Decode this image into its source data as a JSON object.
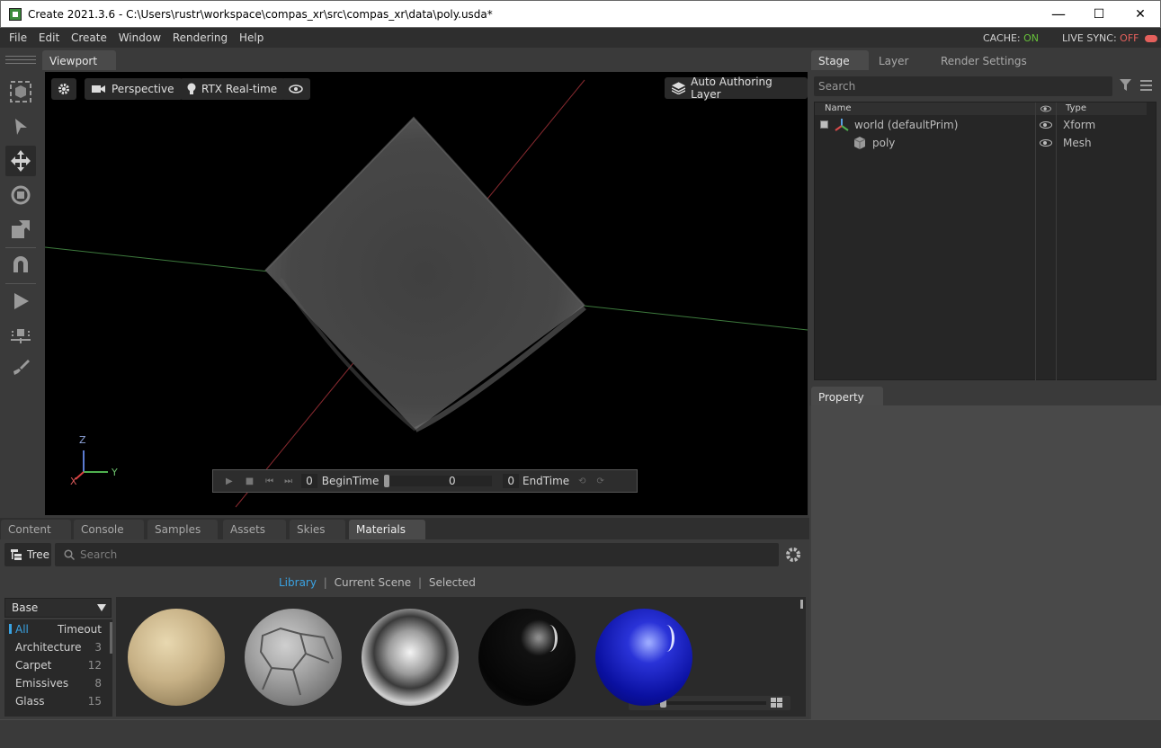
{
  "window": {
    "title": "Create 2021.3.6 - C:\\Users\\rustr\\workspace\\compas_xr\\src\\compas_xr\\data\\poly.usda*",
    "minimize_icon": "—",
    "maximize_icon": "☐",
    "close_icon": "✕"
  },
  "menu": {
    "items": [
      "File",
      "Edit",
      "Create",
      "Window",
      "Rendering",
      "Help"
    ],
    "cache_label": "CACHE:",
    "cache_value": "ON",
    "livesync_label": "LIVE SYNC:",
    "livesync_value": "OFF"
  },
  "viewport": {
    "tab": "Viewport",
    "perspective": "Perspective",
    "renderer": "RTX Real-time",
    "authoring": "Auto Authoring Layer",
    "axis_z": "Z",
    "axis_x": "X",
    "axis_y": "Y"
  },
  "timeline": {
    "start": "0",
    "begin_label": "BeginTime",
    "current": "0",
    "end": "0",
    "end_label": "EndTime"
  },
  "stage": {
    "tabs": [
      "Stage",
      "Layer",
      "Render Settings"
    ],
    "search_placeholder": "Search",
    "col_name": "Name",
    "col_type": "Type",
    "rows": [
      {
        "name": "world (defaultPrim)",
        "type": "Xform"
      },
      {
        "name": "poly",
        "type": "Mesh"
      }
    ]
  },
  "property": {
    "tab": "Property"
  },
  "bottom": {
    "tabs": [
      "Content",
      "Console",
      "Samples",
      "Assets",
      "Skies",
      "Materials"
    ],
    "tree_label": "Tree",
    "search_placeholder": "Search",
    "filters": [
      "Library",
      "Current Scene",
      "Selected"
    ],
    "base_select": "Base",
    "categories": [
      {
        "name": "All",
        "count": "Timeout"
      },
      {
        "name": "Architecture",
        "count": "3"
      },
      {
        "name": "Carpet",
        "count": "12"
      },
      {
        "name": "Emissives",
        "count": "8"
      },
      {
        "name": "Glass",
        "count": "15"
      }
    ],
    "materials": [
      "sandstone",
      "tiles",
      "chrome",
      "black-gloss",
      "blue-gloss"
    ]
  },
  "colors": {
    "accent": "#3aa3e3",
    "on": "#67c23a",
    "off": "#e4605c"
  }
}
